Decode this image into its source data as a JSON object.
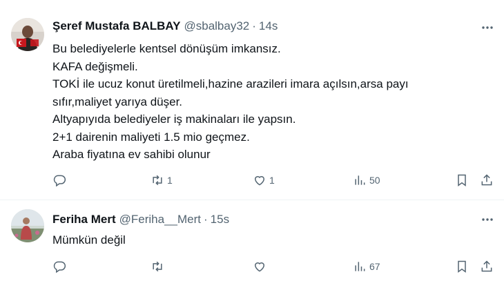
{
  "tweets": [
    {
      "display_name": "Şeref Mustafa BALBAY",
      "handle": "@sbalbay32",
      "separator": "·",
      "time": "14s",
      "lines": [
        "Bu belediyelerle kentsel dönüşüm imkansız.",
        "KAFA değişmeli.",
        "TOKİ ile ucuz konut üretilmeli,hazine arazileri imara açılsın,arsa payı",
        "sıfır,maliyet yarıya düşer.",
        "Altyapıyıda belediyeler iş makinaları ile yapsın.",
        "2+1 dairenin maliyeti 1.5 mio geçmez.",
        "Araba fiyatına ev sahibi olunur"
      ],
      "actions": {
        "reply_count": "",
        "retweet_count": "1",
        "like_count": "1",
        "view_count": "50"
      }
    },
    {
      "display_name": "Feriha Mert",
      "handle": "@Feriha__Mert",
      "separator": "·",
      "time": "15s",
      "lines": [
        "Mümkün değil"
      ],
      "actions": {
        "reply_count": "",
        "retweet_count": "",
        "like_count": "",
        "view_count": "67"
      }
    }
  ],
  "icons": [
    "avatar",
    "more-icon",
    "reply-icon",
    "retweet-icon",
    "like-icon",
    "views-icon",
    "bookmark-icon",
    "share-icon"
  ],
  "colors": {
    "text": "#0f1419",
    "secondary": "#536471",
    "divider": "#eff3f4"
  }
}
